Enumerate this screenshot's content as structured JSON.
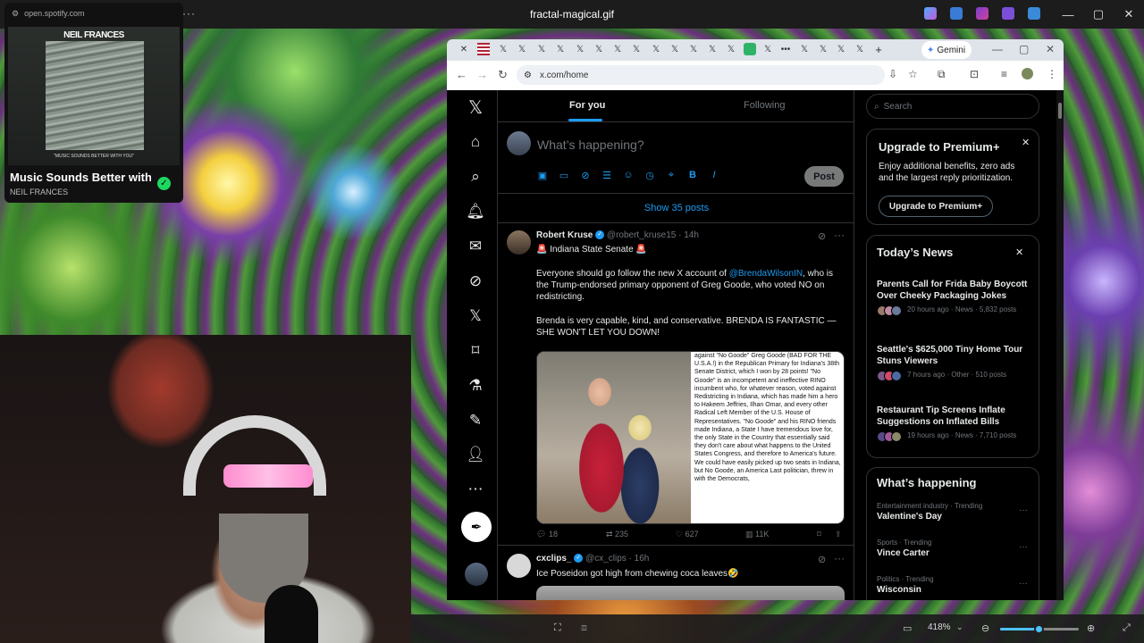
{
  "window": {
    "title": "fractal-magical.gif",
    "min": "—",
    "max": "▢",
    "close": "✕",
    "menu": "···"
  },
  "spotify": {
    "url": "open.spotify.com",
    "album_band": "NEIL FRANCES",
    "album_caption": "\"MUSIC SOUNDS BETTER WITH YOU\"",
    "song": "Music Sounds Better with You",
    "artist": "NEIL FRANCES"
  },
  "browser": {
    "tab_close": "✕",
    "new_tab": "+",
    "gemini_label": "Gemini",
    "url": "x.com/home"
  },
  "x": {
    "tabs": {
      "for_you": "For you",
      "following": "Following"
    },
    "compose": {
      "placeholder": "What’s happening?",
      "post_label": "Post"
    },
    "show_posts": "Show 35 posts",
    "tweet1": {
      "name": "Robert Kruse",
      "handle": "@robert_kruse15",
      "time": "· 14h",
      "line1": "🚨 Indiana State Senate 🚨",
      "body_a": "Everyone should go follow the new X account of ",
      "mention": "@BrendaWilsonIN",
      "body_b": ", who is the Trump-endorsed primary opponent of Greg Goode, who voted NO on redistricting.",
      "body_c": "Brenda is very capable, kind, and conservative. BRENDA IS FANTASTIC — SHE WON'T LET YOU DOWN!",
      "doc_text": "against \"No Goode\" Greg Goode (BAD FOR THE U.S.A.!) in the Republican Primary for Indiana's 38th Senate District, which I won by 28 points! \"No Goode\" is an incompetent and ineffective RINO incumbent who, for whatever reason, voted against Redistricting in Indiana, which has made him a hero to Hakeem Jeffries, Ilhan Omar, and every other Radical Left Member of the U.S. House of Representatives. \"No Goode\" and his RINO friends made Indiana, a State I have tremendous love for, the only State in the Country that essentially said they don't care about what happens to the United States Congress, and therefore to America's future. We could have easily picked up two seats in Indiana, but No Goode, an America Last politician, threw in with the Democrats,",
      "replies": "18",
      "reposts": "235",
      "likes": "627",
      "views": "11K"
    },
    "tweet2": {
      "name": "cxclips_",
      "handle": "@cx_clips",
      "time": "· 16h",
      "text": "Ice Poseidon got high from chewing coca leaves🤣"
    },
    "search_placeholder": "Search",
    "premium": {
      "title": "Upgrade to Premium+",
      "desc": "Enjoy additional benefits, zero ads and the largest reply prioritization.",
      "button": "Upgrade to Premium+"
    },
    "news": {
      "title": "Today’s News",
      "items": [
        {
          "headline": "Parents Call for Frida Baby Boycott Over Cheeky Packaging Jokes",
          "meta": "20 hours ago · News · 5,832 posts"
        },
        {
          "headline": "Seattle's $625,000 Tiny Home Tour Stuns Viewers",
          "meta": "7 hours ago · Other · 510 posts"
        },
        {
          "headline": "Restaurant Tip Screens Inflate Suggestions on Inflated Bills",
          "meta": "19 hours ago · News · 7,710 posts"
        }
      ]
    },
    "happening": {
      "title": "What’s happening",
      "items": [
        {
          "context": "Entertainment industry · Trending",
          "topic": "Valentine's Day"
        },
        {
          "context": "Sports · Trending",
          "topic": "Vince Carter"
        },
        {
          "context": "Politics · Trending",
          "topic": "Wisconsin"
        }
      ]
    }
  },
  "viewer": {
    "zoom": "418%",
    "zoom_level_fraction": 0.5
  },
  "colors": {
    "x_blue": "#1d9bf0",
    "spotify_green": "#1ed760"
  }
}
